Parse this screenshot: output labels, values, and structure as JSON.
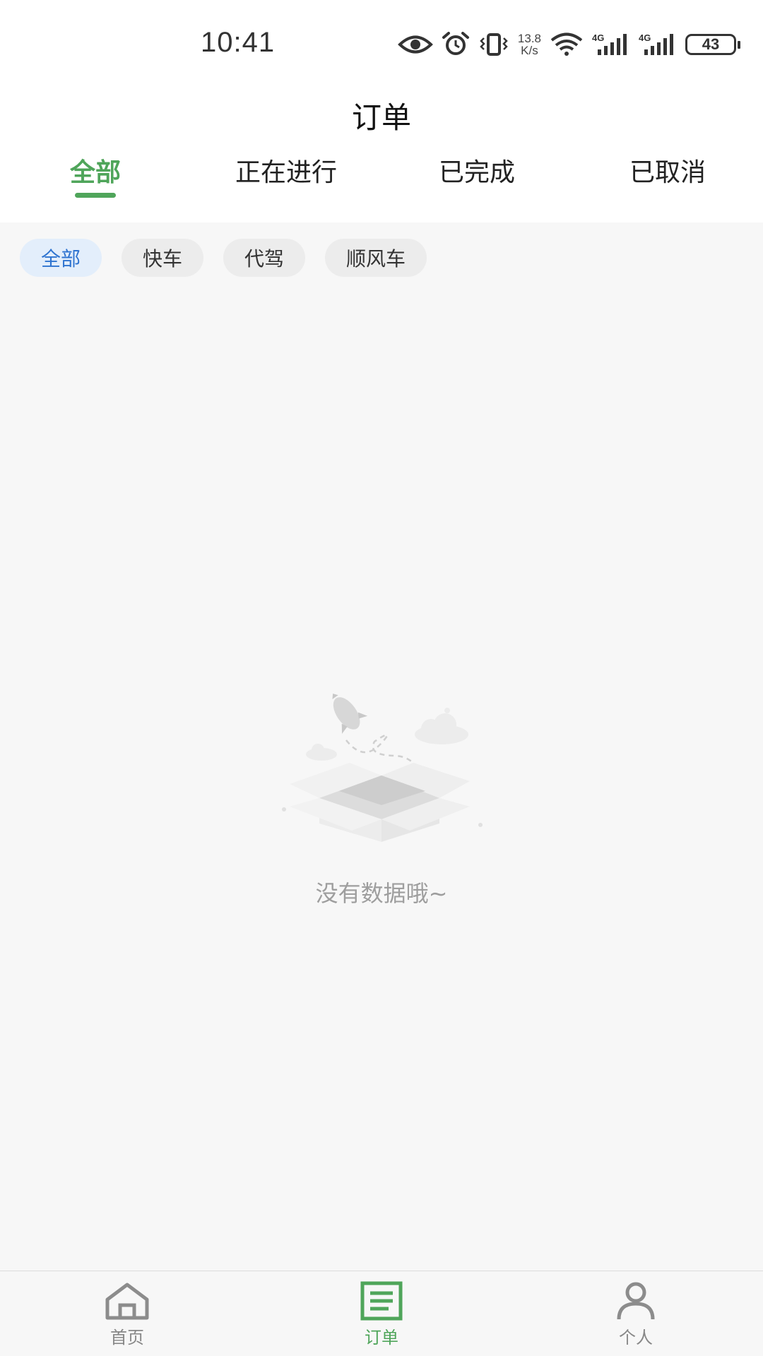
{
  "status_bar": {
    "time": "10:41",
    "net_speed_value": "13.8",
    "net_speed_unit": "K/s",
    "network_type_1": "4G",
    "network_type_2": "4G",
    "battery": "43",
    "icons": [
      "eye-icon",
      "alarm-icon",
      "vibrate-icon",
      "wifi-icon",
      "signal-icon",
      "signal-icon",
      "battery-icon"
    ]
  },
  "header": {
    "title": "订单"
  },
  "tabs": [
    {
      "label": "全部",
      "active": true
    },
    {
      "label": "正在进行",
      "active": false
    },
    {
      "label": "已完成",
      "active": false
    },
    {
      "label": "已取消",
      "active": false
    }
  ],
  "chips": [
    {
      "label": "全部",
      "active": true
    },
    {
      "label": "快车",
      "active": false
    },
    {
      "label": "代驾",
      "active": false
    },
    {
      "label": "顺风车",
      "active": false
    }
  ],
  "empty_state": {
    "message": "没有数据哦~",
    "icon": "empty-box-icon"
  },
  "bottom_nav": [
    {
      "label": "首页",
      "icon": "home-icon",
      "active": false
    },
    {
      "label": "订单",
      "icon": "order-list-icon",
      "active": true
    },
    {
      "label": "个人",
      "icon": "person-icon",
      "active": false
    }
  ],
  "colors": {
    "accent_green": "#4fa55a",
    "chip_active_text": "#2f74d0",
    "chip_active_bg": "#e3eefb",
    "background": "#f7f7f7"
  }
}
